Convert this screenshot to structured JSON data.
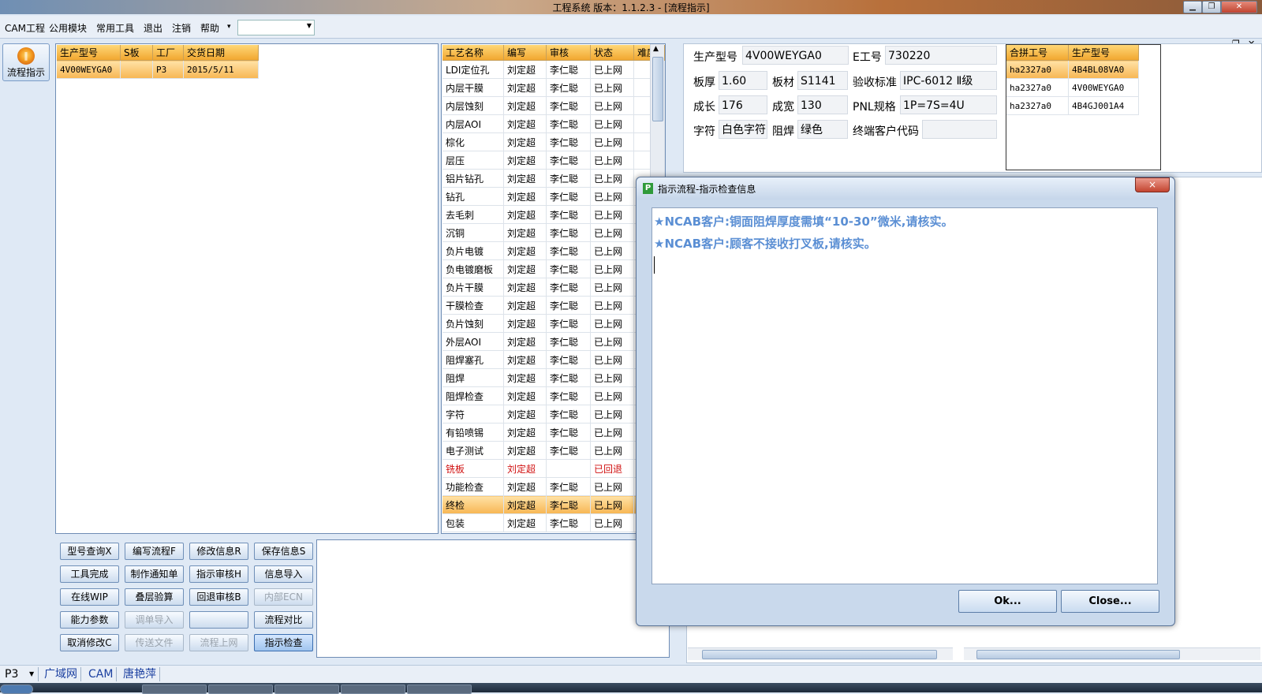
{
  "window": {
    "title": "工程系统   版本：1.1.2.3 - [流程指示]"
  },
  "menu": {
    "items": [
      "CAM工程",
      "公用模块",
      "常用工具",
      "退出",
      "注销",
      "帮助"
    ],
    "help_arrow": "▾"
  },
  "sidebar": {
    "flow_button": "流程指示"
  },
  "order_table": {
    "headers": [
      "生产型号",
      "S板",
      "工厂",
      "交货日期"
    ],
    "rows": [
      [
        "4V00WEYGA0",
        "",
        "P3",
        "2015/5/11"
      ]
    ]
  },
  "process_table": {
    "headers": [
      "工艺名称",
      "编写",
      "审核",
      "状态",
      "难度"
    ],
    "rows": [
      [
        "LDI定位孔",
        "刘定超",
        "李仁聪",
        "已上网",
        ""
      ],
      [
        "内层干膜",
        "刘定超",
        "李仁聪",
        "已上网",
        ""
      ],
      [
        "内层蚀刻",
        "刘定超",
        "李仁聪",
        "已上网",
        ""
      ],
      [
        "内层AOI",
        "刘定超",
        "李仁聪",
        "已上网",
        ""
      ],
      [
        "棕化",
        "刘定超",
        "李仁聪",
        "已上网",
        ""
      ],
      [
        "层压",
        "刘定超",
        "李仁聪",
        "已上网",
        ""
      ],
      [
        "铝片钻孔",
        "刘定超",
        "李仁聪",
        "已上网",
        ""
      ],
      [
        "钻孔",
        "刘定超",
        "李仁聪",
        "已上网",
        ""
      ],
      [
        "去毛刺",
        "刘定超",
        "李仁聪",
        "已上网",
        ""
      ],
      [
        "沉铜",
        "刘定超",
        "李仁聪",
        "已上网",
        ""
      ],
      [
        "负片电镀",
        "刘定超",
        "李仁聪",
        "已上网",
        ""
      ],
      [
        "负电镀磨板",
        "刘定超",
        "李仁聪",
        "已上网",
        ""
      ],
      [
        "负片干膜",
        "刘定超",
        "李仁聪",
        "已上网",
        ""
      ],
      [
        "干膜检查",
        "刘定超",
        "李仁聪",
        "已上网",
        ""
      ],
      [
        "负片蚀刻",
        "刘定超",
        "李仁聪",
        "已上网",
        ""
      ],
      [
        "外层AOI",
        "刘定超",
        "李仁聪",
        "已上网",
        ""
      ],
      [
        "阻焊塞孔",
        "刘定超",
        "李仁聪",
        "已上网",
        ""
      ],
      [
        "阻焊",
        "刘定超",
        "李仁聪",
        "已上网",
        ""
      ],
      [
        "阻焊检查",
        "刘定超",
        "李仁聪",
        "已上网",
        ""
      ],
      [
        "字符",
        "刘定超",
        "李仁聪",
        "已上网",
        ""
      ],
      [
        "有铅喷锡",
        "刘定超",
        "李仁聪",
        "已上网",
        ""
      ],
      [
        "电子测试",
        "刘定超",
        "李仁聪",
        "已上网",
        ""
      ],
      [
        "铣板",
        "刘定超",
        "",
        "已回退",
        ""
      ],
      [
        "功能检查",
        "刘定超",
        "李仁聪",
        "已上网",
        ""
      ],
      [
        "终检",
        "刘定超",
        "李仁聪",
        "已上网",
        ""
      ],
      [
        "包装",
        "刘定超",
        "李仁聪",
        "已上网",
        ""
      ]
    ],
    "selected_index": 24,
    "returned_index": 22,
    "returned_color": "#d01010"
  },
  "info": {
    "model_label": "生产型号",
    "model_value": "4V00WEYGA0",
    "eno_label": "E工号",
    "eno_value": "730220",
    "thickness_label": "板厚",
    "thickness_value": "1.60",
    "material_label": "板材",
    "material_value": "S1141",
    "standard_label": "验收标准",
    "standard_value": "IPC-6012 Ⅱ级",
    "length_label": "成长",
    "length_value": "176",
    "width_label": "成宽",
    "width_value": "130",
    "pnl_label": "PNL规格",
    "pnl_value": "1P=7S=4U",
    "char_label": "字符",
    "char_value": "白色字符",
    "mask_label": "阻焊",
    "mask_value": "绿色",
    "customer_label": "终端客户代码",
    "customer_value": ""
  },
  "combine_table": {
    "headers": [
      "合拼工号",
      "生产型号"
    ],
    "rows": [
      [
        "ha2327a0",
        "4B4BL08VA0"
      ],
      [
        "ha2327a0",
        "4V00WEYGA0"
      ],
      [
        "ha2327a0",
        "4B4GJ001A4"
      ]
    ]
  },
  "buttons": [
    [
      {
        "label": "型号查询X",
        "state": "normal"
      },
      {
        "label": "编写流程F",
        "state": "normal"
      },
      {
        "label": "修改信息R",
        "state": "normal"
      },
      {
        "label": "保存信息S",
        "state": "normal"
      }
    ],
    [
      {
        "label": "工具完成",
        "state": "normal"
      },
      {
        "label": "制作通知单",
        "state": "normal"
      },
      {
        "label": "指示审核H",
        "state": "normal"
      },
      {
        "label": "信息导入",
        "state": "normal"
      }
    ],
    [
      {
        "label": "在线WIP",
        "state": "normal"
      },
      {
        "label": "叠层验算",
        "state": "normal"
      },
      {
        "label": "回退审核B",
        "state": "normal"
      },
      {
        "label": "内部ECN",
        "state": "disabled"
      }
    ],
    [
      {
        "label": "能力参数",
        "state": "normal"
      },
      {
        "label": "调单导入",
        "state": "disabled"
      },
      {
        "label": "",
        "state": "normal"
      },
      {
        "label": "流程对比",
        "state": "normal"
      }
    ],
    [
      {
        "label": "取消修改C",
        "state": "normal"
      },
      {
        "label": "传送文件",
        "state": "disabled"
      },
      {
        "label": "流程上网",
        "state": "disabled"
      },
      {
        "label": "指示检查",
        "state": "active"
      }
    ]
  ],
  "dialog": {
    "title": "指示流程-指示检查信息",
    "close": "×",
    "lines": [
      "★NCAB客户:铜面阻焊厚度需填“10-30”微米,请核实。",
      "★NCAB客户:顾客不接收打叉板,请核实。"
    ],
    "ok": "Ok...",
    "cancel": "Close..."
  },
  "statusbar": {
    "plant": "P3",
    "network": "广域网",
    "module": "CAM",
    "user": "唐艳萍"
  },
  "colors": {
    "accent": "#f1a730",
    "panel_border": "#6f8db5",
    "dialog_text": "#5b8fd4"
  }
}
